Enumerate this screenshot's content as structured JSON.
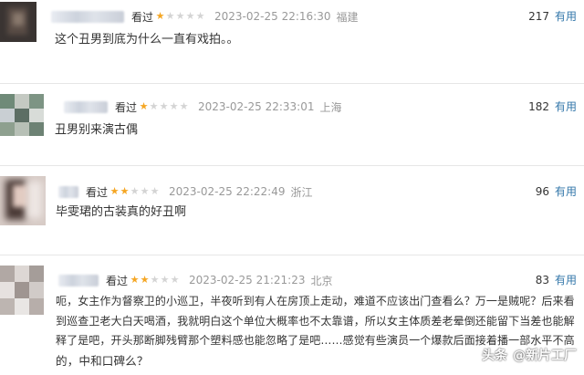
{
  "comments": [
    {
      "seen": "看过",
      "rating": 1,
      "time": "2023-02-25 22:16:30",
      "location": "福建",
      "votes": "217",
      "useful": "有用",
      "text": "这个丑男到底为什么一直有戏拍。。"
    },
    {
      "seen": "看过",
      "rating": 1,
      "time": "2023-02-25 22:33:01",
      "location": "上海",
      "votes": "182",
      "useful": "有用",
      "text": "丑男别来演古偶"
    },
    {
      "seen": "看过",
      "rating": 2,
      "time": "2023-02-25 22:22:49",
      "location": "浙江",
      "votes": "96",
      "useful": "有用",
      "text": "毕雯珺的古装真的好丑啊"
    },
    {
      "seen": "看过",
      "rating": 2,
      "time": "2023-02-25 21:21:23",
      "location": "北京",
      "votes": "83",
      "useful": "有用",
      "text_lines": [
        "呃，女主作为督察卫的小巡卫，半夜听到有人在房顶上走动，难道不应该出门查看么？万一是贼呢？后来看",
        "到巡查卫老大白天喝酒，我就明白这个单位大概率也不太靠谱，所以女主体质差老晕倒还能留下当差也能解",
        "释了是吧，开头那断脚残臂那个塑料感也能忽略了是吧……感觉有些演员一个爆款后面接着播一部水平不高",
        "的，中和口碑么？"
      ]
    }
  ],
  "watermark": {
    "platform": "头条",
    "handle": "@新片工厂"
  },
  "colors": {
    "star_on": "#f5a623",
    "star_off": "#d4d4d4",
    "useful_link": "#3377aa",
    "meta_gray": "#999999"
  }
}
